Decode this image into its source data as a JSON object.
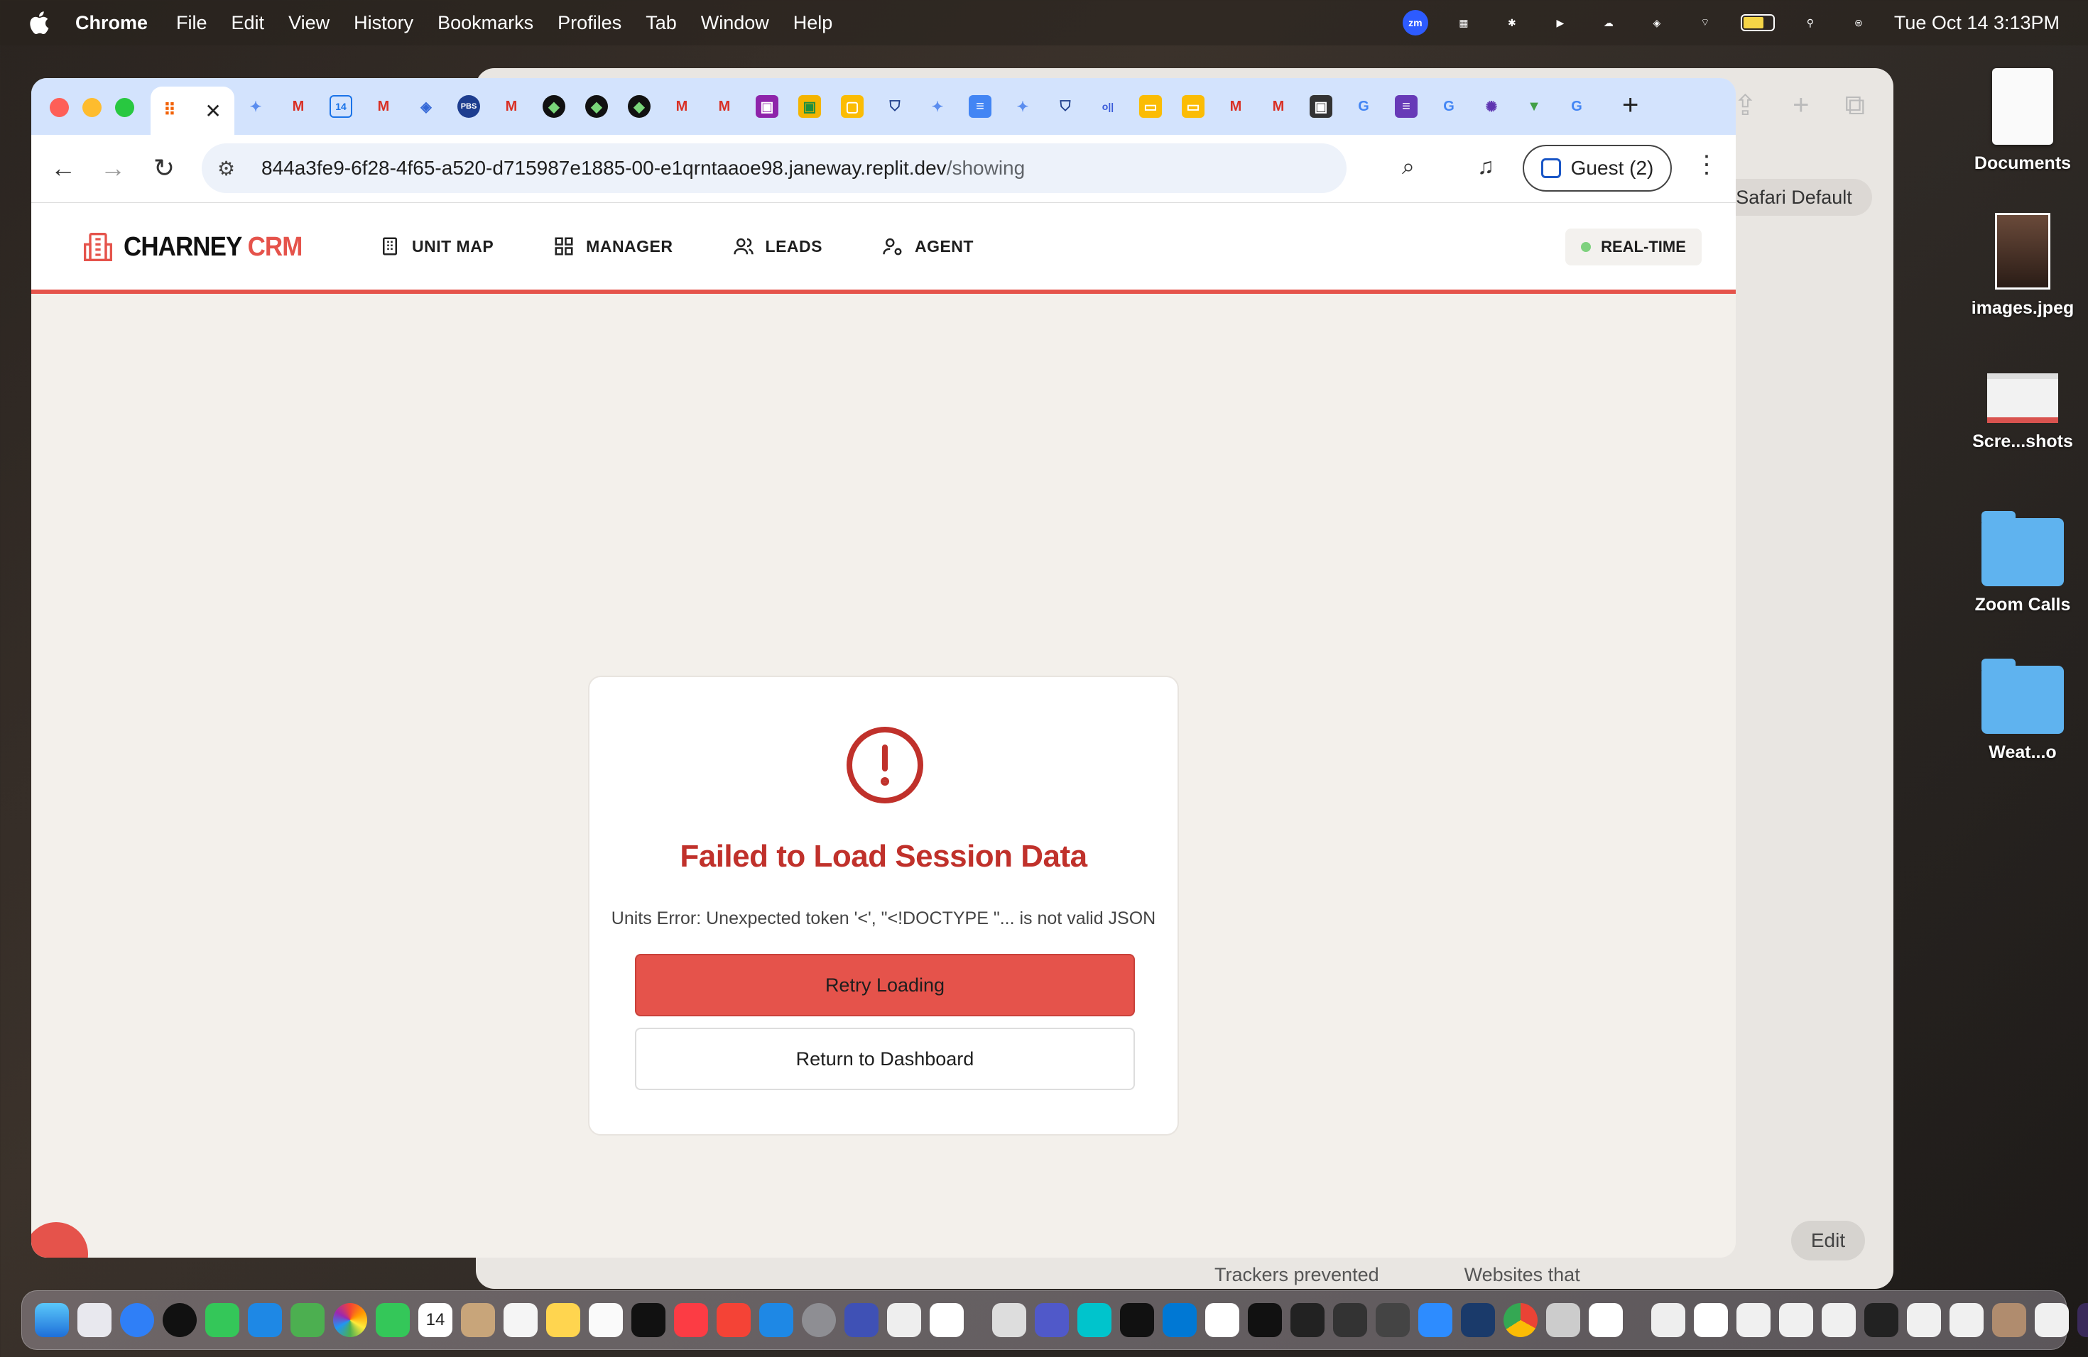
{
  "menubar": {
    "app_name": "Chrome",
    "items": [
      "File",
      "Edit",
      "View",
      "History",
      "Bookmarks",
      "Profiles",
      "Tab",
      "Window",
      "Help"
    ],
    "clock": "Tue Oct 14  3:13PM",
    "zoom_label": "zm"
  },
  "background_window": {
    "safari_default": "Safari Default",
    "edit": "Edit",
    "trackers": "Trackers prevented",
    "websites": "Websites that"
  },
  "browser": {
    "url_host": "844a3fe9-6f28-4f65-a520-d715987e1885-00-e1qrntaaoe98.janeway.replit.dev",
    "url_path": "/showing",
    "profile": "Guest (2)",
    "new_tab": "+"
  },
  "app": {
    "brand_main": "CHARNEY",
    "brand_accent": "CRM",
    "nav": [
      "UNIT MAP",
      "MANAGER",
      "LEADS",
      "AGENT"
    ],
    "status": "REAL-TIME"
  },
  "error": {
    "title": "Failed to Load Session Data",
    "message": "Units Error: Unexpected token '<', \"<!DOCTYPE \"... is not valid JSON",
    "retry_label": "Retry Loading",
    "dashboard_label": "Return to Dashboard"
  },
  "desktop": {
    "items": [
      "Documents",
      "images.jpeg",
      "Scre...shots",
      "Zoom Calls",
      "Weat...o"
    ]
  },
  "dock_calendar_day": "14",
  "colors": {
    "accent": "#e5534b",
    "error_title": "#c0312b",
    "tabstrip": "#d3e3fd",
    "app_bg": "#f3f0eb"
  }
}
